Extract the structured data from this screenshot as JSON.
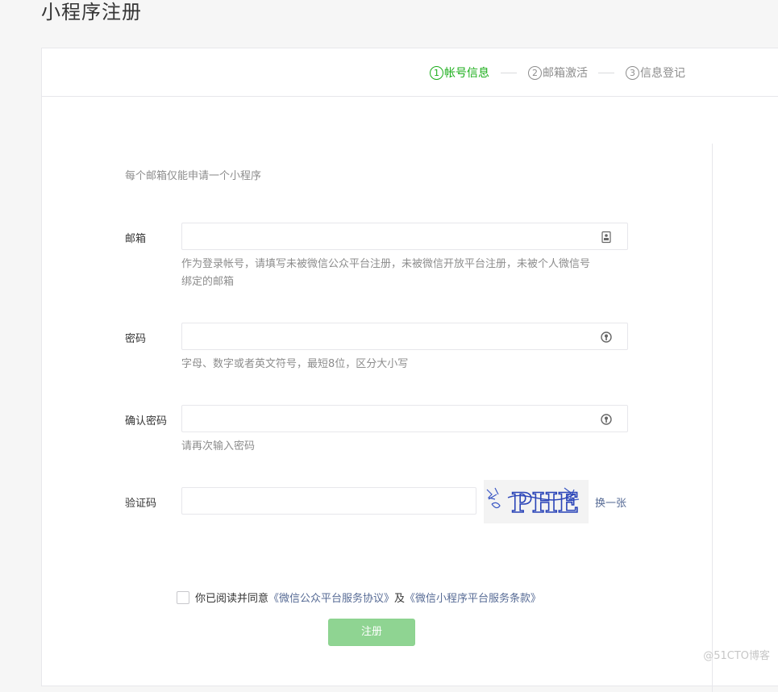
{
  "page_title": "小程序注册",
  "steps": [
    {
      "num": "1",
      "label": "帐号信息",
      "active": true
    },
    {
      "num": "2",
      "label": "邮箱激活",
      "active": false
    },
    {
      "num": "3",
      "label": "信息登记",
      "active": false
    }
  ],
  "intro_text": "每个邮箱仅能申请一个小程序",
  "email": {
    "label": "邮箱",
    "value": "",
    "tip_line1": "作为登录帐号，请填写未被微信公众平台注册，未被微信开放平台注册，未被个人微信号",
    "tip_line2": "绑定的邮箱"
  },
  "password": {
    "label": "密码",
    "value": "",
    "tip": "字母、数字或者英文符号，最短8位，区分大小写"
  },
  "confirm_password": {
    "label": "确认密码",
    "value": "",
    "tip": "请再次输入密码"
  },
  "captcha": {
    "label": "验证码",
    "value": "",
    "image_text": "PHE",
    "refresh_label": "换一张"
  },
  "agreement": {
    "prefix": "你已阅读并同意",
    "link1": "《微信公众平台服务协议》",
    "middle": "及",
    "link2": "《微信小程序平台服务条款》"
  },
  "submit_label": "注册",
  "watermark": "@51CTO博客",
  "colors": {
    "accent": "#1aad19",
    "link": "#576b95",
    "button_disabled": "#8fd492"
  }
}
